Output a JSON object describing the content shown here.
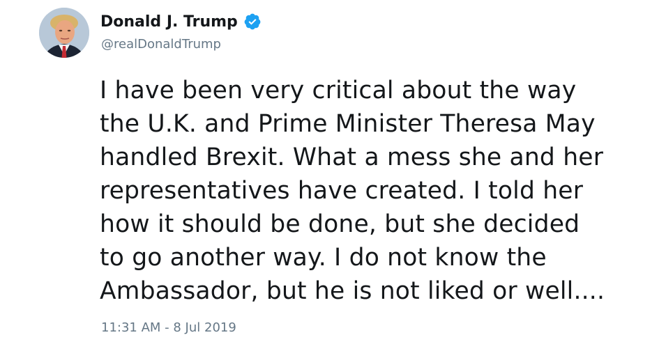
{
  "author": {
    "display_name": "Donald J. Trump",
    "handle": "@realDonaldTrump",
    "verified": true,
    "avatar_icon": "profile-photo-avatar",
    "verified_icon": "verified-badge-icon"
  },
  "tweet": {
    "lines": [
      "I have been very critical about the way",
      "the U.K. and Prime Minister Theresa May",
      "handled Brexit. What a mess she and her",
      "representatives have created. I told her",
      "how it should be done, but she decided",
      "to go another way. I do not know the",
      "Ambassador, but he is not liked or well...."
    ],
    "timestamp": "11:31 AM - 8 Jul 2019"
  },
  "colors": {
    "text": "#14171a",
    "secondary": "#657786",
    "verified": "#1da1f2",
    "background": "#ffffff"
  }
}
